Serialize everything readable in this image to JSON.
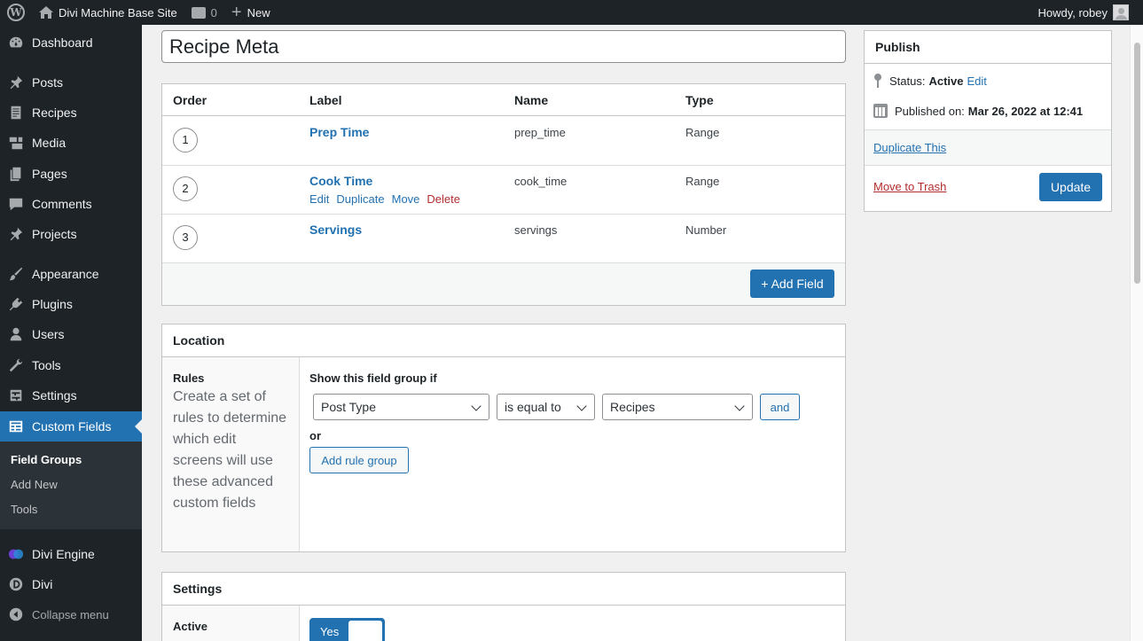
{
  "adminbar": {
    "site_name": "Divi Machine Base Site",
    "comment_count": "0",
    "new_label": "New",
    "howdy": "Howdy, robey"
  },
  "sidebar": {
    "items": [
      {
        "label": "Dashboard",
        "icon": "dashboard-icon"
      },
      {
        "label": "Posts",
        "icon": "pin-icon"
      },
      {
        "label": "Recipes",
        "icon": "document-icon"
      },
      {
        "label": "Media",
        "icon": "media-icon"
      },
      {
        "label": "Pages",
        "icon": "pages-icon"
      },
      {
        "label": "Comments",
        "icon": "comment-icon"
      },
      {
        "label": "Projects",
        "icon": "pin-icon"
      },
      {
        "label": "Appearance",
        "icon": "brush-icon"
      },
      {
        "label": "Plugins",
        "icon": "plugin-icon"
      },
      {
        "label": "Users",
        "icon": "user-icon"
      },
      {
        "label": "Tools",
        "icon": "wrench-icon"
      },
      {
        "label": "Settings",
        "icon": "settings-icon"
      },
      {
        "label": "Custom Fields",
        "icon": "table-icon"
      },
      {
        "label": "Divi Engine",
        "icon": "divi-engine-icon"
      },
      {
        "label": "Divi",
        "icon": "divi-icon"
      }
    ],
    "submenu": [
      "Field Groups",
      "Add New",
      "Tools"
    ],
    "collapse_label": "Collapse menu"
  },
  "title_value": "Recipe Meta",
  "fields_table": {
    "headers": [
      "Order",
      "Label",
      "Name",
      "Type"
    ],
    "rows": [
      {
        "order": "1",
        "label": "Prep Time",
        "name": "prep_time",
        "type": "Range"
      },
      {
        "order": "2",
        "label": "Cook Time",
        "name": "cook_time",
        "type": "Range"
      },
      {
        "order": "3",
        "label": "Servings",
        "name": "servings",
        "type": "Number"
      }
    ],
    "row_actions": [
      "Edit",
      "Duplicate",
      "Move",
      "Delete"
    ],
    "add_field_label": "+ Add Field"
  },
  "location": {
    "title": "Location",
    "rules_title": "Rules",
    "rules_description": "Create a set of rules to determine which edit screens will use these advanced custom fields",
    "show_if": "Show this field group if",
    "param": "Post Type",
    "operator": "is equal to",
    "value": "Recipes",
    "and_label": "and",
    "or_label": "or",
    "add_rule_group": "Add rule group"
  },
  "settings": {
    "title": "Settings",
    "active_label": "Active",
    "toggle_label": "Yes",
    "active": true
  },
  "publish": {
    "title": "Publish",
    "status_label": "Status:",
    "status_value": "Active",
    "edit_link": "Edit",
    "published_label": "Published on:",
    "published_value": "Mar 26, 2022 at 12:41",
    "duplicate_label": "Duplicate This",
    "trash_label": "Move to Trash",
    "update_label": "Update"
  },
  "colors": {
    "admin_dark": "#1d2327",
    "accent": "#2271b1",
    "danger": "#b32d2e"
  }
}
